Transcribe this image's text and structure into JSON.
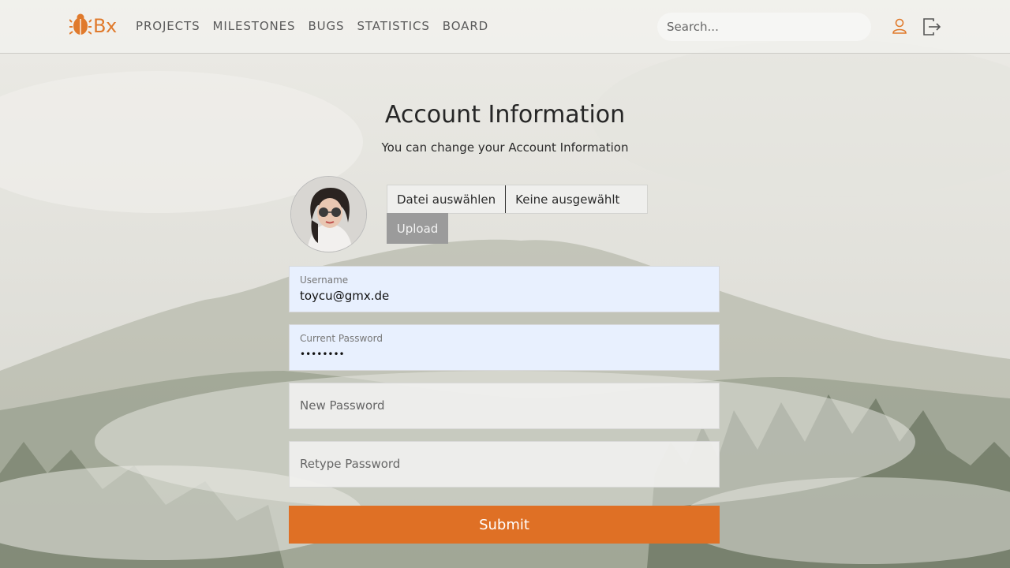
{
  "app": {
    "logo_text": "Bx",
    "brand_color": "#e07a2c"
  },
  "nav": {
    "links": [
      "PROJECTS",
      "MILESTONES",
      "BUGS",
      "STATISTICS",
      "BOARD"
    ],
    "search_placeholder": "Search...",
    "icons": [
      "user-icon",
      "logout-icon"
    ]
  },
  "page": {
    "title": "Account Information",
    "subtitle": "You can change your Account Information"
  },
  "avatar": {
    "icon": "profile-photo"
  },
  "file_upload": {
    "choose_label": "Datei auswählen",
    "status": "Keine ausgewählt",
    "upload_label": "Upload"
  },
  "form": {
    "username": {
      "label": "Username",
      "value": "toycu@gmx.de"
    },
    "current_password": {
      "label": "Current Password",
      "value": "••••••••"
    },
    "new_password": {
      "placeholder": "New Password"
    },
    "retype_password": {
      "placeholder": "Retype Password"
    },
    "submit_label": "Submit",
    "submit_color": "#df7025"
  }
}
